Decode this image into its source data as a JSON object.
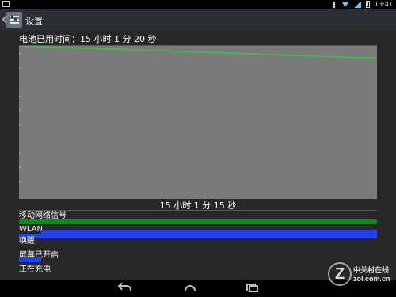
{
  "status_bar": {
    "time": "13:41",
    "icons": [
      "bluetooth-icon",
      "wifi-icon",
      "signal-icon",
      "battery-icon"
    ]
  },
  "action_bar": {
    "title": "设置",
    "icon": "settings-icon"
  },
  "battery": {
    "used_time_label": "电池已用时间：15 小时 1 分 20 秒",
    "chart_caption": "15 小时 1 分 15 秒",
    "level_start": 1.0,
    "level_end": 0.92,
    "line_color": "#3fc24a",
    "fill_color": "#7a7a7a"
  },
  "signals": {
    "mobile_network": "移动网络信号",
    "wlan": "WLAN",
    "wake": "唤醒",
    "screen_on": "屏幕已开启",
    "charging": "正在充电",
    "colors": {
      "green": "#0f8a1e",
      "blue": "#2142e6"
    }
  },
  "watermark": {
    "cn": "中关村在线",
    "en": "zol.com.cn"
  }
}
